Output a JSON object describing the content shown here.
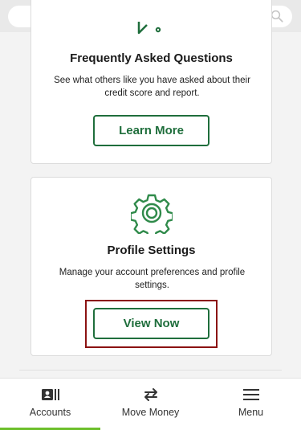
{
  "search": {
    "placeholder": ""
  },
  "faq_card": {
    "title": "Frequently Asked Questions",
    "description": "See what others like you have asked about their credit score and report.",
    "button_label": "Learn More"
  },
  "profile_card": {
    "title": "Profile Settings",
    "description": "Manage your account preferences and profile settings.",
    "button_label": "View Now"
  },
  "bottom_nav": {
    "items": [
      {
        "label": "Accounts",
        "icon": "accounts-icon",
        "active": true
      },
      {
        "label": "Move Money",
        "icon": "transfer-arrows-icon",
        "active": false
      },
      {
        "label": "Menu",
        "icon": "hamburger-menu-icon",
        "active": false
      }
    ]
  },
  "colors": {
    "brand_green": "#1f6e3c",
    "highlight_red": "#8b1212",
    "active_tab": "#6cbf2b"
  }
}
